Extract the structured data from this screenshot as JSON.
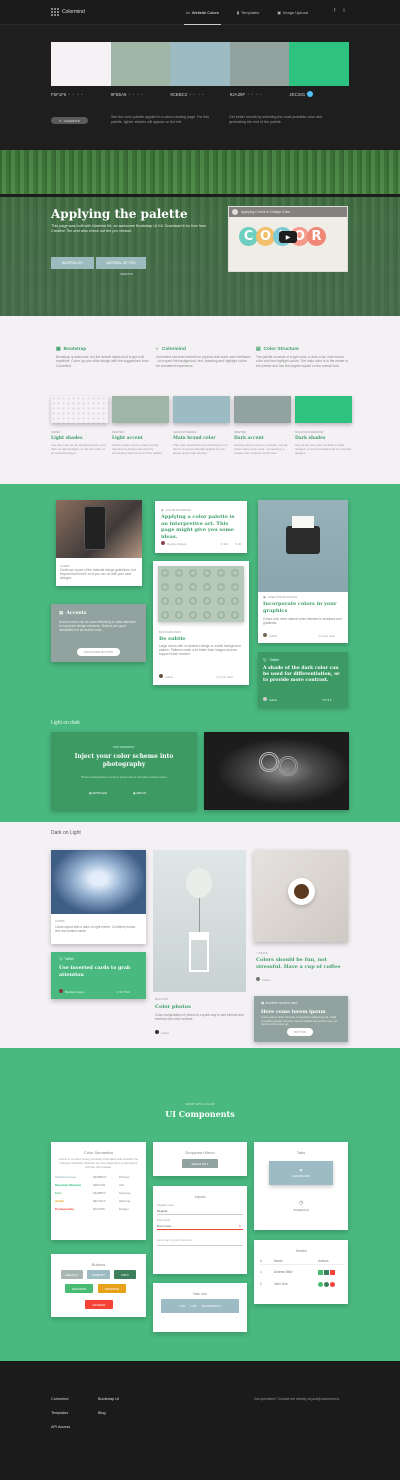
{
  "nav": {
    "brand": "Colormind",
    "links": [
      {
        "label": "Website Colors",
        "icon": "monitor-icon"
      },
      {
        "label": "Templates",
        "icon": "bookmark-icon"
      },
      {
        "label": "Image Upload",
        "icon": "image-icon"
      }
    ]
  },
  "palette": {
    "colors": [
      "#F5F1F5",
      "#9FB5A6",
      "#9CBBC2",
      "#92A39F",
      "#2EC281"
    ],
    "hex": [
      "F5F1F5",
      "9FB5A6",
      "9CBBC2",
      "92A39F",
      "2EC281"
    ]
  },
  "controls": {
    "generate_label": "GENERATE",
    "hint_left": "See the color palette applied to a demo landing page. For this palette, lighter shades will appear on the left.",
    "hint_right": "Get better results by selecting the most probable color and generating the rest of the palette."
  },
  "hero": {
    "title": "Applying the palette",
    "text": "This page was built with Material Kit, an awesome Bootstrap UI Kit. Download it for free from Creative Tim and also check out the pro version.",
    "btn1": "MATERIAL KIT",
    "btn2": "MATERIAL KIT PRO",
    "credit": "CREDITS",
    "video_title": "Applying Colors in Design Color",
    "video_word": [
      "C",
      "O",
      "L",
      "O",
      "R"
    ]
  },
  "features": [
    {
      "title": "Bootstrap",
      "text": "Bootstrap is awesome, but the default styles tend to get a bit repetitive. Cover up your slide design with the suggestions from Colormind."
    },
    {
      "title": "Colormind",
      "text": "Colormind has been trained on popular real world user interfaces - so expect the background, text, branding and highlight colors for consistent experience."
    },
    {
      "title": "Color Structure",
      "text": "The palette consists of a light color, a dark color, main brand color and two highlight colors. The main color is in the center of the palette and has the largest impact on the overall look."
    }
  ],
  "tiles": [
    {
      "cap": "PAPER",
      "title": "Light shades",
      "text": "Use this color as the background for your dark-on-light designs, or the text color of an inverted design.",
      "color": "#F5F1F5"
    },
    {
      "cap": "PEWTER",
      "title": "Light accent",
      "text": "Accent colors can be used to bring attention to design elements by contrasting with the rest of the palette.",
      "color": "#9FB5A6"
    },
    {
      "cap": "SHADOW GREEN",
      "title": "Main brand color",
      "title_note": "",
      "text": "This color should be eye-catching but not harsh. It can be liberally applied to your layout as its main identity.",
      "color": "#9CBBC2"
    },
    {
      "cap": "PEWTER",
      "title": "Dark accent",
      "text": "Another accent color to consider. Not all colors have to be used - sometimes a simple color scheme works best.",
      "color": "#92A39F"
    },
    {
      "cap": "MOUNTAIN MEADOW",
      "title": "Dark shades",
      "text": "Use as the text color for dark-on-light designs, or as the background for inverted designs.",
      "color": "#2EC281"
    }
  ],
  "green_cards": {
    "cards_cap": "CARDS",
    "cards_text": "Cards are a part of the material design guidelines, but beyond that there's a lot you can do with your card designs.",
    "accents_title": "Accents",
    "accents_text": "Accent colors can be used effectively to draw attention to important design elements. Buttons are good candidates for an accent color...",
    "accents_btn": "ADVANCED BUTTON",
    "example_cap": "COLOR EXAMPLES",
    "example_title": "Applying a color palette is an interpretive art. This page might give you some ideas.",
    "example_author": "Rooftop Design",
    "example_stats": [
      "112",
      "40"
    ],
    "bg_cap": "BACKGROUNDS",
    "bg_title": "Be subtle",
    "bg_text": "Large colors with no abstract design or subtle background pattern. Patterns make a lot better than images and are support when needed",
    "bg_author": "Author",
    "bg_time": "3 min read",
    "inspire_cap": "CREATIVE BLOGGING",
    "inspire_title": "Incorporate colors in your graphics",
    "inspire_text": "Colors look more natural when blended in shadows and gradients.",
    "inspire_author": "Author",
    "inspire_time": "4 min read",
    "twitter_label": "Twitter",
    "twitter_text": "A shade of the dark color can be used for differentiation, or to provide more contrast.",
    "twitter_author": "Author",
    "twitter_stats": "5",
    "twitter_likes": "6"
  },
  "light_on_dark": {
    "heading": "Light on dark",
    "cap": "PHOTOGRAPHY",
    "title": "Inject your color scheme into photography",
    "text": "Photo manipulation can be a great way to introduce brand colors",
    "link1": "ARTICLES",
    "link2": "ABOUT"
  },
  "dark_on_light": {
    "heading": "Dark on Light",
    "cap1": "CARDS",
    "text1": "Cards layout with a dark on light theme. Combine photos, text and related cards.",
    "twitter_label": "Twitter",
    "twitter_title": "Use inverted cards to grab attention",
    "twitter_author": "Rooftop Design",
    "twitter_stats": [
      "34",
      "10"
    ],
    "cap2": "BALLOON",
    "title2": "Color photos",
    "text2": "Color manipulation of photos is a quick way to add interest and reinforce the color scheme.",
    "author2": "Author",
    "cap3": "MUGS",
    "title3": "Colors should be fun, not stressful. Have a cup of coffee",
    "author3": "Author",
    "accent_label": "Another accent card",
    "accent_title": "Here come lorem ipsum",
    "accent_text": "Lorem ipsum dolor sit amet, consectetur adipiscing elit. Nulla convallis egestas rhoncus. Donec facilisis fermentum sem, ac viverra ante luctus vel.",
    "accent_btn": "BUTTON"
  },
  "components": {
    "kicker": "WORK WITH COLOR",
    "title": "UI Components",
    "semantics": {
      "title": "Color Semantics",
      "text": "Colors in UI often convey semantic information and shouldn't be changed arbitrarily. However we can nudge them to harmonize with the color palette.",
      "rows": [
        [
          "Shadow Green",
          "#9CBBC2",
          "Primary"
        ],
        [
          "Mountain Meadow",
          "#2EC281",
          "Info"
        ],
        [
          "Fern",
          "#4ABB72",
          "Success"
        ],
        [
          "Amber",
          "#E7A01A",
          "Warning"
        ],
        [
          "Pomegranate",
          "#F44336",
          "Danger"
        ]
      ]
    },
    "buttons": {
      "title": "Buttons",
      "labels": [
        "DEFAULT",
        "PRIMARY",
        "INFO",
        "SUCCESS",
        "WARNING",
        "DANGER"
      ]
    },
    "dropdown": {
      "title": "Dropdown Menu",
      "btn": "REGULAR"
    },
    "inputs": {
      "title": "Inputs",
      "l1": "Regular input",
      "v1": "Regular",
      "l2": "Error input",
      "v2": "Error Input",
      "placeholder": "Here can be your blue text"
    },
    "navbar": {
      "title": "Nav bar",
      "items": [
        "LINK",
        "LINK",
        "DROPDOWN"
      ]
    },
    "tabs": {
      "title": "Tabs",
      "tab": "DASHBOARD",
      "tab2": "SCHEDULE"
    },
    "tables": {
      "title": "Tables",
      "headers": [
        "#",
        "Name",
        "Actions"
      ],
      "rows": [
        [
          "1",
          "Andrew Mike"
        ],
        [
          "2",
          "John Doe"
        ]
      ]
    }
  },
  "footer": {
    "col1": [
      "Colormind",
      "Templates",
      "API Access"
    ],
    "col2": [
      "Bootstrap UI",
      "Blog"
    ],
    "contact": "Got questions? Contact me directly at jack@colormind.io"
  }
}
